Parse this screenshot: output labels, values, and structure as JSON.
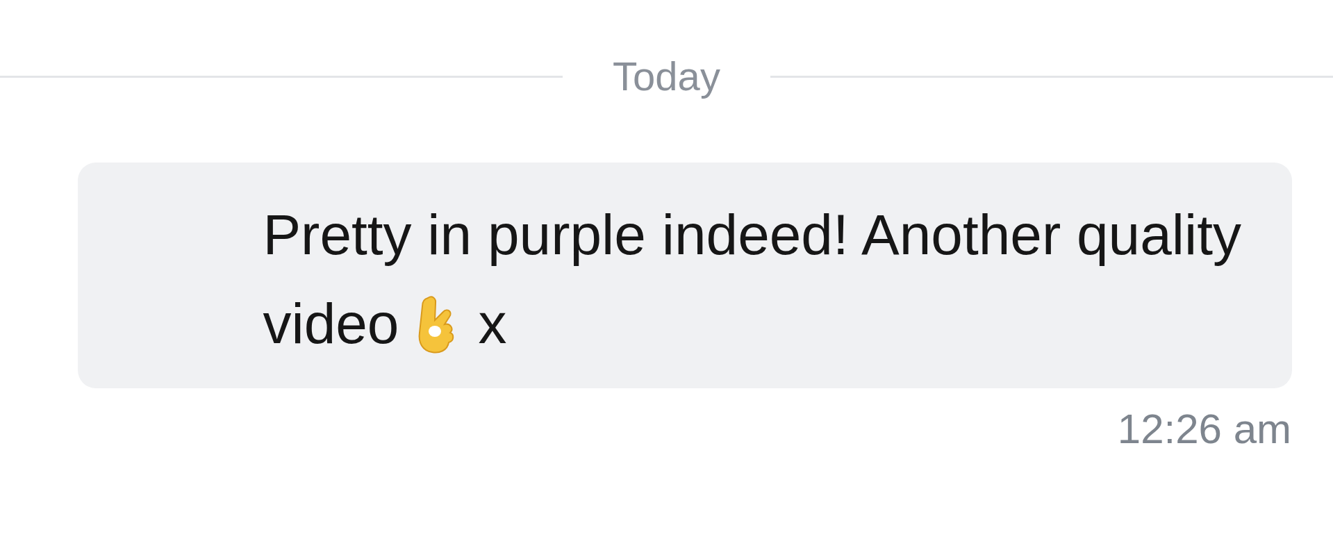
{
  "date_divider": "Today",
  "message": {
    "lines": [
      "Pretty in purple indeed! Another quality",
      "video"
    ],
    "suffix": "x",
    "time": "12:26 am"
  }
}
